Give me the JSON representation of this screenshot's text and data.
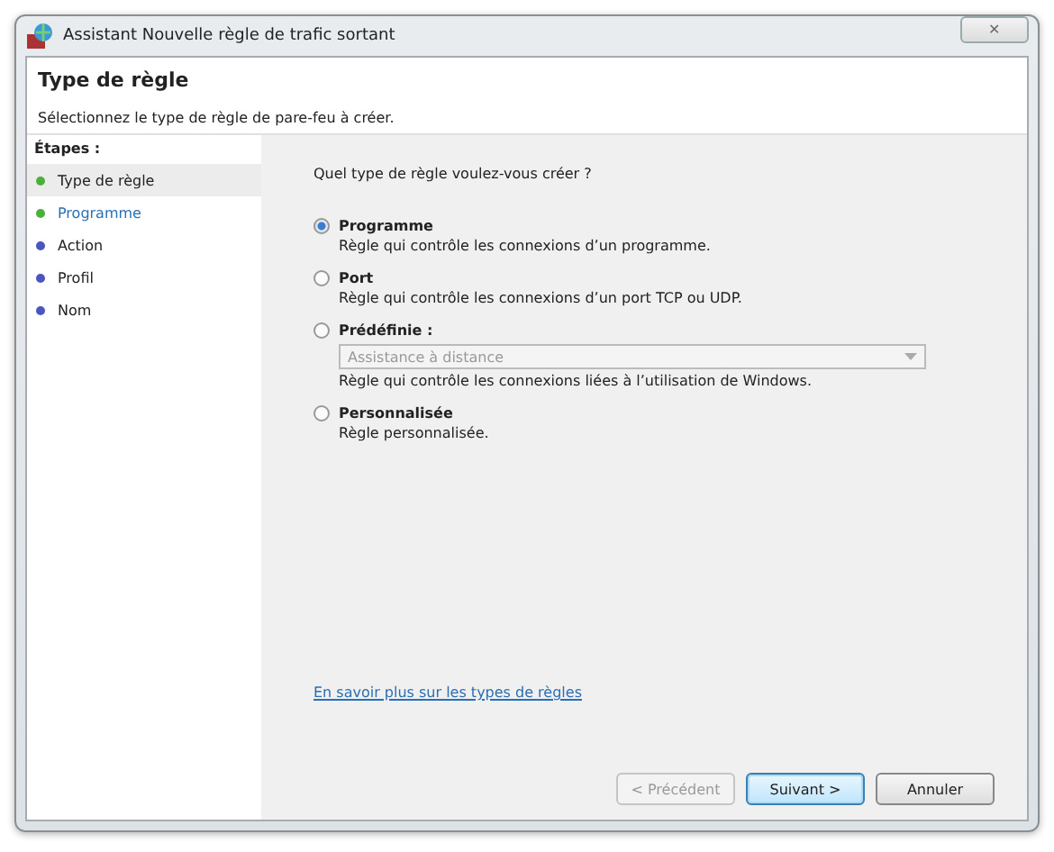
{
  "window": {
    "title": "Assistant Nouvelle règle de trafic sortant",
    "close": "✕"
  },
  "header": {
    "title": "Type de règle",
    "subtitle": "Sélectionnez le type de règle de pare-feu à créer."
  },
  "steps": {
    "heading": "Étapes :",
    "items": [
      {
        "label": "Type de règle",
        "color": "#4caf3a",
        "selected": true,
        "kind": "text"
      },
      {
        "label": "Programme",
        "color": "#4caf3a",
        "selected": false,
        "kind": "link"
      },
      {
        "label": "Action",
        "color": "#4a55c0",
        "selected": false,
        "kind": "text"
      },
      {
        "label": "Profil",
        "color": "#4a55c0",
        "selected": false,
        "kind": "text"
      },
      {
        "label": "Nom",
        "color": "#4a55c0",
        "selected": false,
        "kind": "text"
      }
    ]
  },
  "question": "Quel type de règle voulez-vous créer ?",
  "options": [
    {
      "title": "Programme",
      "description": "Règle qui contrôle les connexions d’un programme.",
      "selected": true
    },
    {
      "title": "Port",
      "description": "Règle qui contrôle les connexions d’un port TCP ou UDP.",
      "selected": false
    },
    {
      "title": "Prédéfinie :",
      "dropdown": {
        "value": "Assistance à distance",
        "disabled": true
      },
      "description": "Règle qui contrôle les connexions liées à l’utilisation de Windows.",
      "selected": false
    },
    {
      "title": "Personnalisée",
      "description": "Règle personnalisée.",
      "selected": false
    }
  ],
  "link": "En savoir plus sur les types de règles",
  "buttons": [
    {
      "label": "< Précédent",
      "disabled": true,
      "default": false
    },
    {
      "label": "Suivant >",
      "disabled": false,
      "default": true
    },
    {
      "label": "Annuler",
      "disabled": false,
      "default": false
    }
  ]
}
